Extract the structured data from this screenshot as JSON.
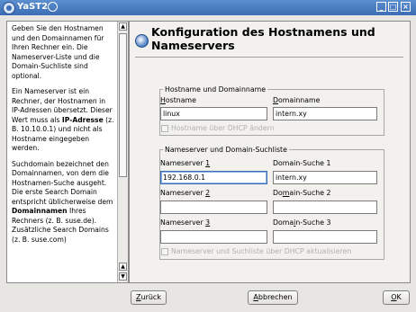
{
  "window": {
    "title": "YaST2"
  },
  "help": {
    "paragraphs": [
      "Geben Sie den Hostnamen und den Domainnamen für Ihren Rechner ein. Die Nameserver-Liste und die Domain-Suchliste sind optional.",
      "Ein Nameserver ist ein Rechner, der Hostnamen in IP-Adressen übersetzt. Dieser Wert muss als <b>IP-Adresse</b> (z. B. 10.10.0.1) und nicht als Hostname eingegeben werden.",
      "Suchdomain bezeichnet den Domainnamen, von dem die Hostnamen-Suche ausgeht. Die erste Search Domain entspricht üblicherweise dem <b>Domainnamen</b> Ihres Rechners (z. B. suse.de). Zusätzliche Search Domains (z. B. suse.com)"
    ]
  },
  "page": {
    "title": "Konfiguration des Hostnamens und Nameservers"
  },
  "hostname_group": {
    "legend": "Hostname und Domainname",
    "hostname_label": "Hostname",
    "hostname_value": "linux",
    "domain_label": "Domainname",
    "domain_value": "intern.xy",
    "dhcp_checkbox_label": "Hostname über DHCP ändern"
  },
  "nameserver_group": {
    "legend": "Nameserver und Domain-Suchliste",
    "ns1_label": "Nameserver 1",
    "ns1_value": "192.168.0.1",
    "ns2_label": "Nameserver 2",
    "ns2_value": "",
    "ns3_label": "Nameserver 3",
    "ns3_value": "",
    "ds1_label": "Domain-Suche 1",
    "ds1_value": "intern.xy",
    "ds2_label": "Domain-Suche 2",
    "ds2_value": "",
    "ds3_label": "Domain-Suche 3",
    "ds3_value": "",
    "dhcp_checkbox_label": "Nameserver und Suchliste über DHCP aktualisieren"
  },
  "buttons": {
    "back": "Zurück",
    "abort": "Abbrechen",
    "ok": "OK"
  }
}
